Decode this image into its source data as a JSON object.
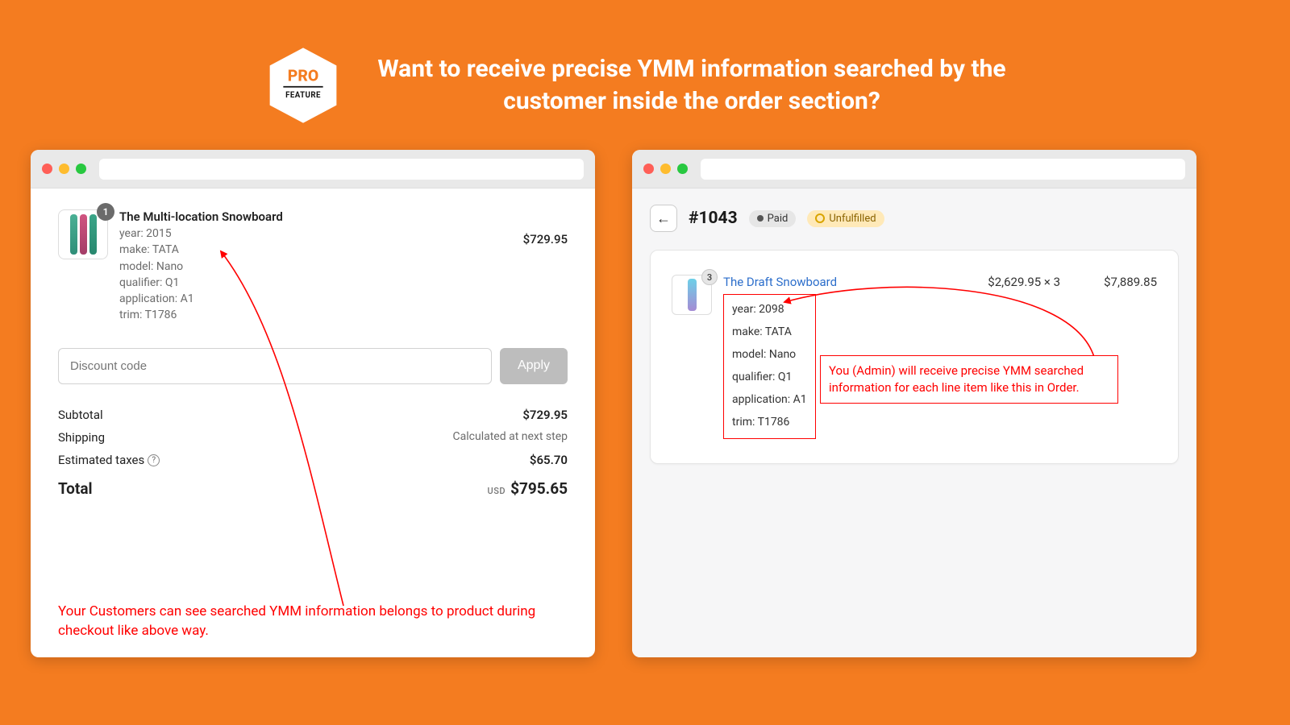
{
  "header": {
    "badge_top": "PRO",
    "badge_bottom": "FEATURE",
    "headline": "Want to receive precise YMM information searched by the customer inside the order section?"
  },
  "checkout": {
    "item": {
      "badge_qty": "1",
      "title": "The Multi-location Snowboard",
      "ymm": {
        "year": "year: 2015",
        "make": "make: TATA",
        "model": "model: Nano",
        "qualifier": "qualifier: Q1",
        "application": "application: A1",
        "trim": "trim: T1786"
      },
      "price": "$729.95"
    },
    "discount_placeholder": "Discount code",
    "apply_label": "Apply",
    "subtotal_label": "Subtotal",
    "subtotal_value": "$729.95",
    "shipping_label": "Shipping",
    "shipping_value": "Calculated at next step",
    "taxes_label": "Estimated taxes",
    "taxes_value": "$65.70",
    "total_label": "Total",
    "total_currency": "USD",
    "total_value": "$795.65",
    "callout": "Your Customers can see searched YMM information belongs to product during checkout like above way."
  },
  "admin": {
    "order_number": "#1043",
    "paid_label": "Paid",
    "unfulfilled_label": "Unfulfilled",
    "item": {
      "badge_qty": "3",
      "title": "The Draft Snowboard",
      "ymm": {
        "year": "year: 2098",
        "make": "make: TATA",
        "model": "model: Nano",
        "qualifier": "qualifier: Q1",
        "application": "application: A1",
        "trim": "trim: T1786"
      },
      "price_mul": "$2,629.95 × 3",
      "price_total": "$7,889.85"
    },
    "callout": "You (Admin) will receive precise YMM searched information for each line item like this in Order."
  }
}
